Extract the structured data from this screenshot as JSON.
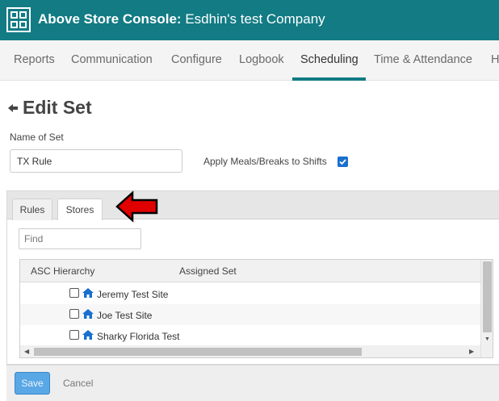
{
  "header": {
    "brand": "Above Store Console:",
    "company": "Esdhin's test Company",
    "logo_icon": "asc-logo-icon"
  },
  "nav": {
    "items": [
      {
        "label": "Reports"
      },
      {
        "label": "Communication"
      },
      {
        "label": "Configure"
      },
      {
        "label": "Logbook"
      },
      {
        "label": "Scheduling"
      },
      {
        "label": "Time & Attendance"
      },
      {
        "label": "H"
      }
    ],
    "active": "Scheduling",
    "accent_color": "#127b84"
  },
  "page": {
    "title": "Edit Set",
    "back_icon": "arrow-left-icon"
  },
  "form": {
    "name_label": "Name of Set",
    "name_value": "TX Rule",
    "meals_label": "Apply Meals/Breaks to Shifts",
    "meals_checked": true
  },
  "tabs": {
    "items": [
      {
        "label": "Rules"
      },
      {
        "label": "Stores"
      }
    ],
    "active": "Stores"
  },
  "stores": {
    "find_placeholder": "Find",
    "columns": [
      "ASC Hierarchy",
      "Assigned Set"
    ],
    "rows": [
      {
        "name": "Jeremy Test Site",
        "assigned": "",
        "checked": false,
        "icon": "home-icon"
      },
      {
        "name": "Joe Test Site",
        "assigned": "",
        "checked": false,
        "icon": "home-icon"
      },
      {
        "name": "Sharky Florida Test",
        "assigned": "",
        "checked": false,
        "icon": "home-icon"
      }
    ]
  },
  "annotation": {
    "icon": "red-arrow-icon",
    "color": "#e00000"
  },
  "footer": {
    "save_label": "Save",
    "cancel_label": "Cancel"
  }
}
